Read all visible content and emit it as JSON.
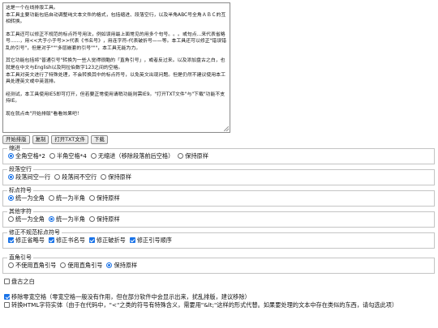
{
  "editor": {
    "paragraphs": [
      "这是一个在线排版工具。\n本工具主要功能包括自动调整纯文本文件的格式，包括缩进、段落空行，以及半角ABC号全角ＡＢＣ的互相转换。",
      "本工具还可以修正不规范的标点符号用法，例如误用最上面常见的用多个句号。。。或句点...来代表省略号……，用<<大于小于号>>代表《书名号》，用连字符-代表破折号——等。本工具还可以修正\"错误错乱的引号\"，但是对于\"\"\"多层嵌套的引号\"\"\"，本工具无能为力。",
      "其它功能包括将\"普通引号\"转换为一些人觉得很酷的「直角引号」，或者反过来。以及添加盘古之白，也就是在中文与English以及阿拉伯数字123之间的空格。\n本工具对英文进行了特殊处理，不会转换其中的标点符号，以免英文出现问题。但是仍然不建议使用本工具处理英文或中英混排。",
      "经测试，本工具使用IE5即可打开，但若要正常使用请稍功能则需IE9。\"打开TXT文件\"与\"下载\"功能不支持IE。",
      "现在就点击\"开始排版\"看看效果吧！"
    ]
  },
  "toolbar": {
    "start": "开始排版",
    "copy": "复制",
    "open_txt": "打开TXT文件",
    "download": "下载"
  },
  "groups": {
    "indent": {
      "legend": "缩进",
      "options": [
        "全角空格*2",
        "半角空格*4",
        "无缩进（移除段落前后空格）",
        "保持原样"
      ],
      "selected": 0
    },
    "blank_line": {
      "legend": "段落空行",
      "options": [
        "段落间空一行",
        "段落间不空行",
        "保持原样"
      ],
      "selected": 0
    },
    "punct": {
      "legend": "标点符号",
      "options": [
        "统一为全角",
        "统一为半角",
        "保持原样"
      ],
      "selected": 0
    },
    "alnum": {
      "legend": "其他字符",
      "options": [
        "统一为全角",
        "统一为半角",
        "保持原样"
      ],
      "selected": 1
    },
    "fix_punct": {
      "legend": "修正不规范标点符号",
      "options": [
        "修正省略号",
        "修正书名号",
        "修正破折号",
        "修正引号顺序"
      ],
      "checked": [
        true,
        true,
        true,
        true
      ]
    },
    "quote": {
      "legend": "直角引号",
      "options": [
        "不使用直角引号",
        "使用直角引号",
        "保持原样"
      ],
      "selected": 2
    }
  },
  "pangu": {
    "label": "盘古之白",
    "checked": false
  },
  "zero_width": {
    "label": "移除零宽空格（零宽空格一般没有作用，但在部分软件中会显示出来，扰乱排版，建议移除）",
    "checked": true
  },
  "html_entity": {
    "label": "转换HTML字符实体（由于在代码中，\"<\"之类的符号有特殊含义，需要用\"&lt;\"这样的形式代替。如果要处理的文本中存在类似的东西，请勾选此项）",
    "checked": false
  },
  "colors": {
    "accent": "#1a73e8"
  }
}
